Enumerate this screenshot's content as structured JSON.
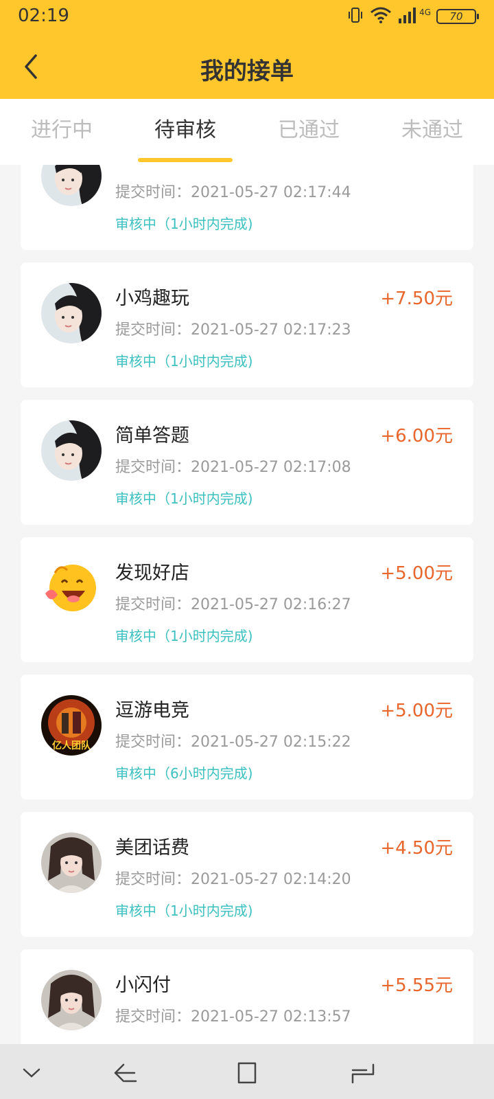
{
  "status_bar": {
    "time": "02:19",
    "battery": "70",
    "network": "4G",
    "icons": [
      "vibrate-icon",
      "wifi-icon",
      "signal-icon",
      "battery-icon"
    ]
  },
  "header": {
    "title": "我的接单",
    "back_icon": "chevron-left-icon"
  },
  "tabs": [
    {
      "label": "进行中",
      "active": false
    },
    {
      "label": "待审核",
      "active": true
    },
    {
      "label": "已通过",
      "active": false
    },
    {
      "label": "未通过",
      "active": false
    }
  ],
  "orders": [
    {
      "name": "",
      "reward": "",
      "submit_label": "提交时间：",
      "submit_time": "2021-05-27 02:17:44",
      "status": "审核中（1小时内完成)",
      "avatar": "girl"
    },
    {
      "name": "小鸡趣玩",
      "reward": "+7.50元",
      "submit_label": "提交时间：",
      "submit_time": "2021-05-27 02:17:23",
      "status": "审核中（1小时内完成)",
      "avatar": "girl"
    },
    {
      "name": "简单答题",
      "reward": "+6.00元",
      "submit_label": "提交时间：",
      "submit_time": "2021-05-27 02:17:08",
      "status": "审核中（1小时内完成)",
      "avatar": "girl"
    },
    {
      "name": "发现好店",
      "reward": "+5.00元",
      "submit_label": "提交时间：",
      "submit_time": "2021-05-27 02:16:27",
      "status": "审核中（1小时内完成)",
      "avatar": "emoji"
    },
    {
      "name": "逗游电竞",
      "reward": "+5.00元",
      "submit_label": "提交时间：",
      "submit_time": "2021-05-27 02:15:22",
      "status": "审核中（6小时内完成)",
      "avatar": "team",
      "avatar_text": "亿人团队"
    },
    {
      "name": "美团话费",
      "reward": "+4.50元",
      "submit_label": "提交时间：",
      "submit_time": "2021-05-27 02:14:20",
      "status": "审核中（1小时内完成)",
      "avatar": "girl2"
    },
    {
      "name": "小闪付",
      "reward": "+5.55元",
      "submit_label": "提交时间：",
      "submit_time": "2021-05-27 02:13:57",
      "status": "",
      "avatar": "girl2"
    }
  ],
  "colors": {
    "header_bg": "#FFC72C",
    "reward": "#E8652B",
    "status": "#3CC0C0",
    "tab_active": "#333333",
    "tab_inactive": "#bcbcbc"
  },
  "system_nav": {
    "icons": [
      "chevron-down-icon",
      "back-icon",
      "home-icon",
      "recents-icon"
    ]
  }
}
